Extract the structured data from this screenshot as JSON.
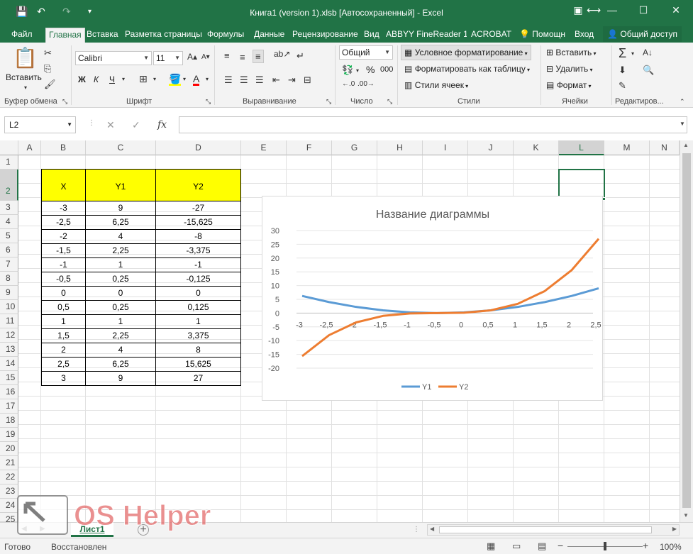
{
  "window": {
    "title": "Книга1 (version 1).xlsb [Автосохраненный] - Excel",
    "qa_save": "💾",
    "qa_undo": "↶",
    "qa_redo": "↷",
    "qa_custom": "▾",
    "ribbon_display": "▣",
    "fullscreen": "⟷",
    "minimize": "—",
    "maximize": "☐",
    "close": "✕"
  },
  "tabs": [
    "Файл",
    "Главная",
    "Вставка",
    "Разметка страницы",
    "Формулы",
    "Данные",
    "Рецензирование",
    "Вид",
    "ABBYY FineReader 12",
    "ACROBAT"
  ],
  "tell_me": "Помощн",
  "signin": "Вход",
  "share": "Общий доступ",
  "ribbon": {
    "paste": "Вставить",
    "font_name": "Calibri",
    "font_size": "11",
    "bold": "Ж",
    "italic": "К",
    "underline": "Ч",
    "number_format": "Общий",
    "percent": "%",
    "thousands": "000",
    "cond_format": "Условное форматирование",
    "format_table": "Форматировать как таблицу",
    "cell_styles": "Стили ячеек",
    "insert": "Вставить",
    "delete": "Удалить",
    "format": "Формат",
    "groups": {
      "clipboard": "Буфер обмена",
      "font": "Шрифт",
      "alignment": "Выравнивание",
      "number": "Число",
      "styles": "Стили",
      "cells": "Ячейки",
      "editing": "Редактиров..."
    }
  },
  "namebox": "L2",
  "fx": "fx",
  "columns": [
    "A",
    "B",
    "C",
    "D",
    "E",
    "F",
    "G",
    "H",
    "I",
    "J",
    "K",
    "L",
    "M",
    "N"
  ],
  "rows": [
    "1",
    "2",
    "3",
    "4",
    "5",
    "6",
    "7",
    "8",
    "9",
    "10",
    "11",
    "12",
    "13",
    "14",
    "15",
    "16",
    "17",
    "18",
    "19",
    "20",
    "21",
    "22",
    "23",
    "24",
    "25"
  ],
  "table": {
    "headers": [
      "X",
      "Y1",
      "Y2"
    ],
    "rows": [
      [
        "-3",
        "9",
        "-27"
      ],
      [
        "-2,5",
        "6,25",
        "-15,625"
      ],
      [
        "-2",
        "4",
        "-8"
      ],
      [
        "-1,5",
        "2,25",
        "-3,375"
      ],
      [
        "-1",
        "1",
        "-1"
      ],
      [
        "-0,5",
        "0,25",
        "-0,125"
      ],
      [
        "0",
        "0",
        "0"
      ],
      [
        "0,5",
        "0,25",
        "0,125"
      ],
      [
        "1",
        "1",
        "1"
      ],
      [
        "1,5",
        "2,25",
        "3,375"
      ],
      [
        "2",
        "4",
        "8"
      ],
      [
        "2,5",
        "6,25",
        "15,625"
      ],
      [
        "3",
        "9",
        "27"
      ]
    ]
  },
  "chart_data": {
    "type": "line",
    "title": "Название диаграммы",
    "categories": [
      "-3",
      "-2,5",
      "-2",
      "-1,5",
      "-1",
      "-0,5",
      "0",
      "0,5",
      "1",
      "1,5",
      "2",
      "2,5"
    ],
    "series": [
      {
        "name": "Y1",
        "color": "#5b9bd5",
        "values": [
          6.25,
          4,
          2.25,
          1,
          0.25,
          0,
          0.25,
          1,
          2.25,
          4,
          6.25,
          9
        ]
      },
      {
        "name": "Y2",
        "color": "#ed7d31",
        "values": [
          -15.625,
          -8,
          -3.375,
          -1,
          -0.125,
          0,
          0.125,
          1,
          3.375,
          8,
          15.625,
          27
        ]
      }
    ],
    "yticks": [
      "30",
      "25",
      "20",
      "15",
      "10",
      "5",
      "0",
      "-5",
      "-10",
      "-15",
      "-20"
    ],
    "ylim": [
      -20,
      30
    ],
    "grid": true,
    "legend": "bottom"
  },
  "sheet_tab": "Лист1",
  "add_sheet": "+",
  "status": {
    "ready": "Готово",
    "restored": "Восстановлен",
    "zoom": "100%",
    "zoom_minus": "−",
    "zoom_plus": "+"
  },
  "watermark": {
    "text": "OS Helper"
  }
}
